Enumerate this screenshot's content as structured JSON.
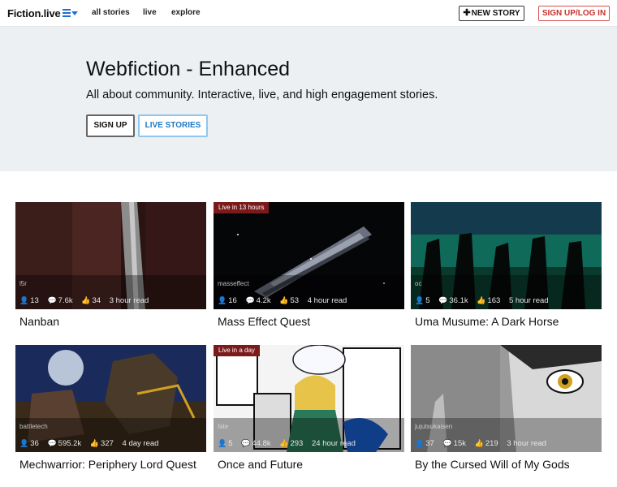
{
  "nav": {
    "brand": "Fiction.live",
    "links": [
      "all stories",
      "live",
      "explore"
    ],
    "new_story": "NEW STORY",
    "login": "SIGN UP/LOG IN"
  },
  "hero": {
    "title": "Webfiction - Enhanced",
    "subtitle": "All about community. Interactive, live, and high engagement stories.",
    "signup": "SIGN UP",
    "live": "LIVE STORIES"
  },
  "stories": [
    {
      "title": "Nanban",
      "tag": "l5r",
      "badge": "",
      "readers": "13",
      "comments": "7.6k",
      "likes": "34",
      "read": "3 hour read"
    },
    {
      "title": "Mass Effect Quest",
      "tag": "masseffect",
      "badge": "Live in 13 hours",
      "readers": "16",
      "comments": "4.2k",
      "likes": "53",
      "read": "4 hour read"
    },
    {
      "title": "Uma Musume: A Dark Horse",
      "tag": "oc",
      "badge": "",
      "readers": "5",
      "comments": "36.1k",
      "likes": "163",
      "read": "5 hour read"
    },
    {
      "title": "Mechwarrior: Periphery Lord Quest",
      "tag": "battletech",
      "badge": "",
      "readers": "36",
      "comments": "595.2k",
      "likes": "327",
      "read": "4 day read"
    },
    {
      "title": "Once and Future",
      "tag": "fate",
      "badge": "Live in a day",
      "readers": "5",
      "comments": "44.8k",
      "likes": "293",
      "read": "24 hour read"
    },
    {
      "title": "By the Cursed Will of My Gods",
      "tag": "jujutsukaisen",
      "badge": "",
      "readers": "37",
      "comments": "15k",
      "likes": "219",
      "read": "3 hour read"
    }
  ],
  "colors": {
    "accent_blue": "#1f6fd1",
    "login_red": "#c9302c",
    "badge": "#7a1a1a",
    "hero_bg": "#edf0f3"
  },
  "icons": {
    "readers": "user-icon",
    "comments": "comment-icon",
    "likes": "thumbs-up-icon",
    "menu": "menu-icon"
  }
}
